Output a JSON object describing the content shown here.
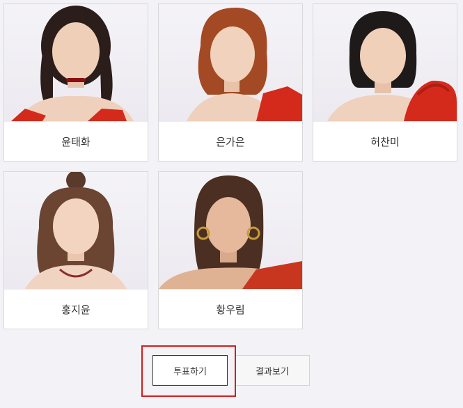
{
  "candidates": [
    {
      "name": "윤태화"
    },
    {
      "name": "은가은"
    },
    {
      "name": "허찬미"
    },
    {
      "name": "홍지윤"
    },
    {
      "name": "황우림"
    }
  ],
  "actions": {
    "vote_label": "투표하기",
    "result_label": "결과보기"
  },
  "colors": {
    "background": "#f3f2f6",
    "highlight": "#d81b1b",
    "outfit": "#d42a1c"
  }
}
